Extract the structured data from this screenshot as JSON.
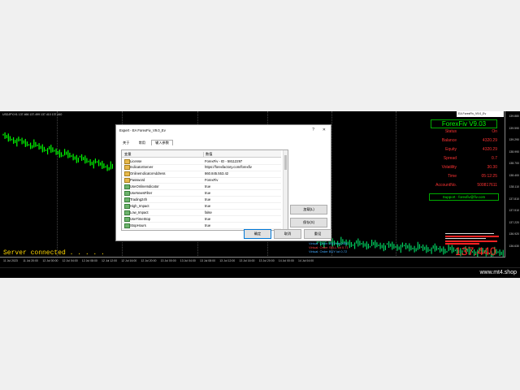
{
  "chart": {
    "symbol_line": "USDJPY,H1  137.466  137.499  137.410  137.440",
    "price_labels": [
      "139.880",
      "139.590",
      "139.290",
      "138.990",
      "138.700",
      "138.400",
      "138.110",
      "137.810",
      "137.510",
      "137.220",
      "136.920",
      "136.630"
    ],
    "time_labels": [
      "11 Jul 2023",
      "11 Jul 20:00",
      "12 Jul 00:00",
      "12 Jul 04:00",
      "12 Jul 08:00",
      "12 Jul 12:00",
      "12 Jul 16:00",
      "12 Jul 20:00",
      "13 Jul 00:00",
      "13 Jul 04:00",
      "13 Jul 08:00",
      "13 Jul 12:00",
      "13 Jul 16:00",
      "13 Jul 20:00",
      "14 Jul 00:00",
      "14 Jul 04:00"
    ],
    "server_text": "Server connected . . . . .",
    "big_price": "137.440",
    "top_tab": "EA ForexFiv_V9.0_Ev",
    "trade_lines": [
      "Virtual: Order BUY lot 0.85",
      "Virtual: Order SELL lot 0.71",
      "Virtual: Order BUY lot 0.72"
    ]
  },
  "panel": {
    "title": "ForexFiv V9.03",
    "rows": [
      {
        "k": "Status",
        "v": "On"
      },
      {
        "k": "Balance",
        "v": "4320.29"
      },
      {
        "k": "Equity",
        "v": "4320.29"
      },
      {
        "k": "Spread",
        "v": "0.7"
      },
      {
        "k": "Volatility",
        "v": "30.30"
      },
      {
        "k": "Time",
        "v": "05:12:25"
      },
      {
        "k": "AccountNo.",
        "v": "500817611"
      }
    ],
    "support": "Support : forexfiv@fiv.com"
  },
  "bottombar": {
    "brand": "www.mt4.shop"
  },
  "dialog": {
    "title": "Expert - EA ForexFiv_V9.0_Ev",
    "help": "?",
    "close": "✕",
    "tabs": [
      "关于",
      "常用",
      "输入参数"
    ],
    "col_var": "变量",
    "col_val": "数值",
    "rows": [
      {
        "k": "License",
        "v": "ForexFiv - ID - 58112297",
        "icon": "y"
      },
      {
        "k": "IndicatorServer",
        "v": "https://forexfactory.com/forexfiv",
        "icon": "y"
      },
      {
        "k": "OnlineIndicatorAddress",
        "v": "860.845.553.42",
        "icon": "y"
      },
      {
        "k": "Password",
        "v": "ForexFiv",
        "icon": "y"
      },
      {
        "k": "UseOnlineIndicator",
        "v": "true",
        "icon": "b"
      },
      {
        "k": "UseNewsFilter",
        "v": "true",
        "icon": "b"
      },
      {
        "k": "Trading24h",
        "v": "true",
        "icon": "b"
      },
      {
        "k": "High_Impact",
        "v": "true",
        "icon": "b"
      },
      {
        "k": "Low_Impact",
        "v": "false",
        "icon": "b"
      },
      {
        "k": "UseTimeStop",
        "v": "true",
        "icon": "b"
      },
      {
        "k": "StopHours",
        "v": "true",
        "icon": "b"
      }
    ],
    "load_btn": "加载(L)",
    "save_btn": "保存(S)",
    "ok_btn": "确定",
    "cancel_btn": "取消",
    "reset_btn": "重设"
  }
}
